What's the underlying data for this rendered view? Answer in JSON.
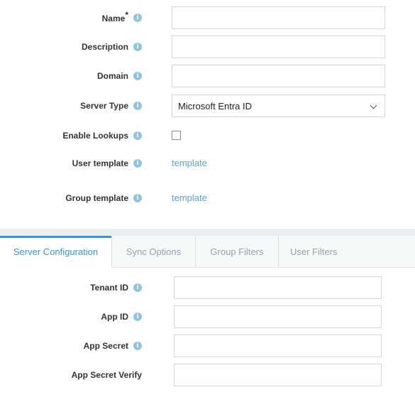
{
  "colors": {
    "accent": "#3a96ce",
    "link": "#5b9fd3",
    "info_icon": "#8ec5e2",
    "label_text": "#333333",
    "input_border": "#d6d6d6",
    "tab_inactive_bg": "#f7f9f9",
    "tab_band": "#ebeef0",
    "tab_inactive_text": "#9aa0ab"
  },
  "top_form": {
    "fields": [
      {
        "label": "Name",
        "required": true,
        "has_info": true,
        "type": "text",
        "value": "",
        "placeholder": ""
      },
      {
        "label": "Description",
        "required": false,
        "has_info": true,
        "type": "text",
        "value": "",
        "placeholder": ""
      },
      {
        "label": "Domain",
        "required": false,
        "has_info": true,
        "type": "text",
        "value": "",
        "placeholder": ""
      },
      {
        "label": "Server Type",
        "required": false,
        "has_info": true,
        "type": "select",
        "value": "Microsoft Entra ID",
        "options": [
          "Microsoft Entra ID"
        ]
      },
      {
        "label": "Enable Lookups",
        "required": false,
        "has_info": true,
        "type": "checkbox",
        "checked": false
      },
      {
        "label": "User template",
        "required": false,
        "has_info": true,
        "type": "link",
        "value": "template"
      },
      {
        "label": "Group template",
        "required": false,
        "has_info": true,
        "type": "link",
        "value": "template"
      }
    ]
  },
  "tabs": {
    "items": [
      {
        "label": "Server Configuration",
        "active": true
      },
      {
        "label": "Sync Options",
        "active": false
      },
      {
        "label": "Group Filters",
        "active": false
      },
      {
        "label": "User Filters",
        "active": false
      }
    ]
  },
  "bottom_form": {
    "fields": [
      {
        "label": "Tenant ID",
        "required": false,
        "has_info": true,
        "type": "text",
        "value": "",
        "placeholder": ""
      },
      {
        "label": "App ID",
        "required": false,
        "has_info": true,
        "type": "text",
        "value": "",
        "placeholder": ""
      },
      {
        "label": "App Secret",
        "required": false,
        "has_info": true,
        "type": "text",
        "value": "",
        "placeholder": ""
      },
      {
        "label": "App Secret Verify",
        "required": false,
        "has_info": false,
        "type": "text",
        "value": "",
        "placeholder": ""
      }
    ]
  }
}
